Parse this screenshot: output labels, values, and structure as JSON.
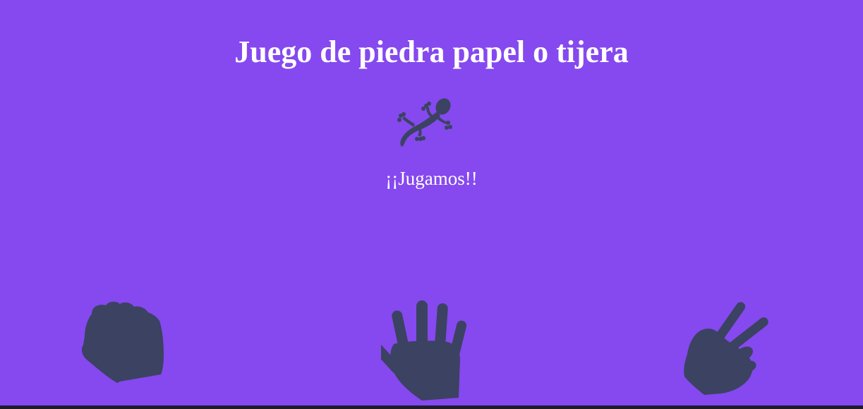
{
  "title": "Juego de piedra papel o tijera",
  "status_text": "¡¡Jugamos!!",
  "colors": {
    "background": "#8549ef",
    "icon": "#3b4262",
    "text": "#ffffff"
  },
  "icons": {
    "computer": "lizard-icon",
    "choices": [
      "rock-hand-icon",
      "paper-hand-icon",
      "scissors-hand-icon"
    ]
  }
}
